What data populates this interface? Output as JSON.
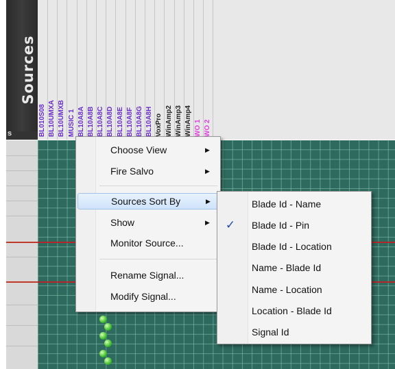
{
  "panel": {
    "title": "Sources",
    "corner_label": "s"
  },
  "columns": [
    {
      "label": "BL010S08",
      "color": "#6a2fc9"
    },
    {
      "label": "BL10UMXA",
      "color": "#6a2fc9"
    },
    {
      "label": "BL10UMXB",
      "color": "#6a2fc9"
    },
    {
      "label": "MUSIC 1",
      "color": "#6a2fc9"
    },
    {
      "label": "BL10A8A",
      "color": "#6a2fc9"
    },
    {
      "label": "BL10A8B",
      "color": "#6a2fc9"
    },
    {
      "label": "BL10A8C",
      "color": "#6a2fc9"
    },
    {
      "label": "BL10A8D",
      "color": "#6a2fc9"
    },
    {
      "label": "BL10A8E",
      "color": "#6a2fc9"
    },
    {
      "label": "BL10A8F",
      "color": "#6a2fc9"
    },
    {
      "label": "BL10A8G",
      "color": "#6a2fc9"
    },
    {
      "label": "BL10A8H",
      "color": "#6a2fc9"
    },
    {
      "label": "VoxPro",
      "color": "#222222"
    },
    {
      "label": "WinAmp2",
      "color": "#222222"
    },
    {
      "label": "WinAmp3",
      "color": "#222222"
    },
    {
      "label": "WinAmp4",
      "color": "#222222"
    },
    {
      "label": "WO 1",
      "color": "#e040e0"
    },
    {
      "label": "WO 2",
      "color": "#e040e0"
    }
  ],
  "context_menu": {
    "items": [
      {
        "label": "Choose View",
        "submenu": true
      },
      {
        "label": "Fire Salvo",
        "submenu": true
      },
      {
        "label": "Sources Sort By",
        "submenu": true,
        "highlighted": true
      },
      {
        "label": "Show",
        "submenu": true
      },
      {
        "label": "Monitor Source...",
        "submenu": false
      },
      {
        "label": "Rename Signal...",
        "submenu": false
      },
      {
        "label": "Modify Signal...",
        "submenu": false
      }
    ]
  },
  "sort_submenu": {
    "items": [
      {
        "label": "Blade Id - Name",
        "checked": false
      },
      {
        "label": "Blade Id - Pin",
        "checked": true
      },
      {
        "label": "Blade Id - Location",
        "checked": false
      },
      {
        "label": "Name - Blade Id",
        "checked": false
      },
      {
        "label": "Name - Location",
        "checked": false
      },
      {
        "label": "Location - Blade Id",
        "checked": false
      },
      {
        "label": "Signal Id",
        "checked": false
      }
    ],
    "check_icon": "checkmark-icon"
  },
  "icons": {
    "submenu_arrow": "submenu-arrow-icon"
  },
  "colors": {
    "grid": "#2f6a5f",
    "route_line": "#b3262b",
    "crosspoint": "#3fbf2f"
  }
}
